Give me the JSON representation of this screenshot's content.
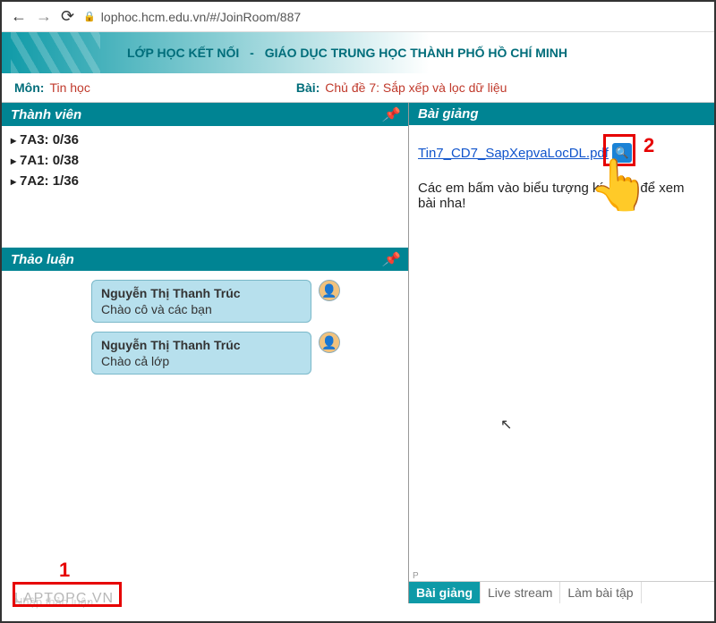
{
  "browser": {
    "url": "lophoc.hcm.edu.vn/#/JoinRoom/887"
  },
  "header": {
    "brand": "LỚP HỌC KẾT NỐI",
    "sep": "-",
    "title": "GIÁO DỤC TRUNG HỌC THÀNH PHỐ HỒ CHÍ MINH"
  },
  "meta": {
    "subjectLabel": "Môn:",
    "subject": "Tin học",
    "lessonLabel": "Bài:",
    "lesson": "Chủ đề 7: Sắp xếp và lọc dữ liệu"
  },
  "panels": {
    "members": "Thành viên",
    "discussion": "Thảo luận",
    "lecture": "Bài giảng"
  },
  "members": [
    "7A3: 0/36",
    "7A1: 0/38",
    "7A2: 1/36"
  ],
  "chats": [
    {
      "name": "Nguyễn Thị Thanh Trúc",
      "text": "Chào cô và các bạn"
    },
    {
      "name": "Nguyễn Thị Thanh Trúc",
      "text": "Chào cả lớp"
    }
  ],
  "lecture": {
    "pdf": "Tin7_CD7_SapXepvaLocDL.pdf",
    "instruction_a": "Các em bấm vào biểu tượng kí",
    "instruction_b": "để xem bài nha!"
  },
  "tabs": {
    "lecture": "Bài giảng",
    "live": "Live stream",
    "exercise": "Làm bài tập"
  },
  "chatInput": {
    "placeholder": "Nhập thảo luận"
  },
  "watermark": "LAPTOPC.VN",
  "annotations": {
    "one": "1",
    "two": "2"
  }
}
